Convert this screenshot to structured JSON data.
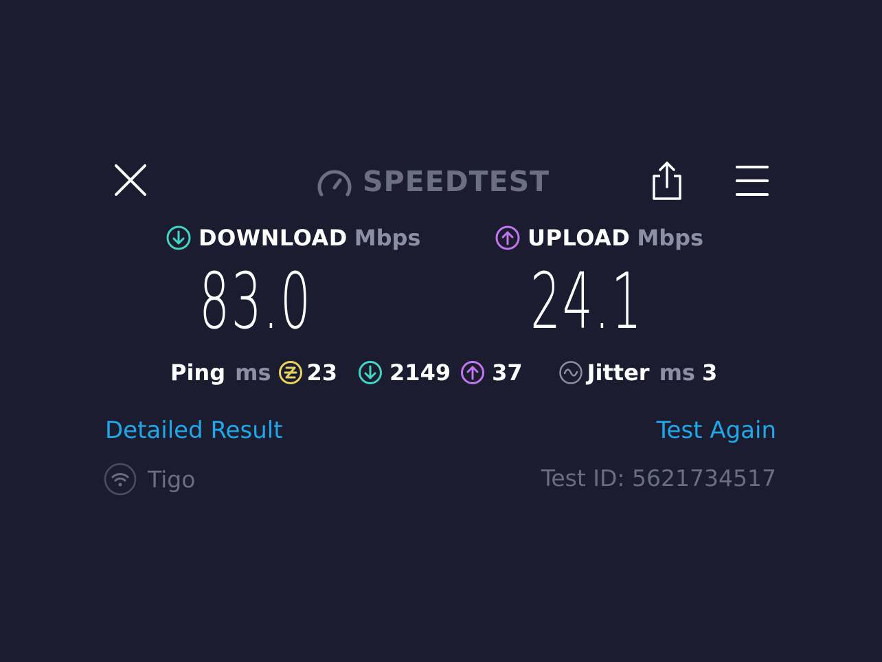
{
  "header": {
    "close_icon": "close-icon",
    "logo_text": "SPEEDTEST",
    "logo_mark": "™",
    "share_icon": "share-icon",
    "menu_icon": "menu-icon"
  },
  "download": {
    "label": "DOWNLOAD",
    "unit": "Mbps",
    "value": "83.0",
    "icon": "download-arrow-icon",
    "color": "#3fd6c7"
  },
  "upload": {
    "label": "UPLOAD",
    "unit": "Mbps",
    "value": "24.1",
    "icon": "upload-arrow-icon",
    "color": "#c376f2"
  },
  "ping": {
    "label": "Ping",
    "unit": "ms",
    "idle_value": "23",
    "idle_color": "#e8d45d",
    "download_value": "2149",
    "upload_value": "37"
  },
  "jitter": {
    "label": "Jitter",
    "unit": "ms",
    "value": "3"
  },
  "actions": {
    "detailed_result": "Detailed Result",
    "test_again": "Test Again"
  },
  "footer": {
    "provider": "Tigo",
    "test_id": "Test ID: 5621734517"
  }
}
